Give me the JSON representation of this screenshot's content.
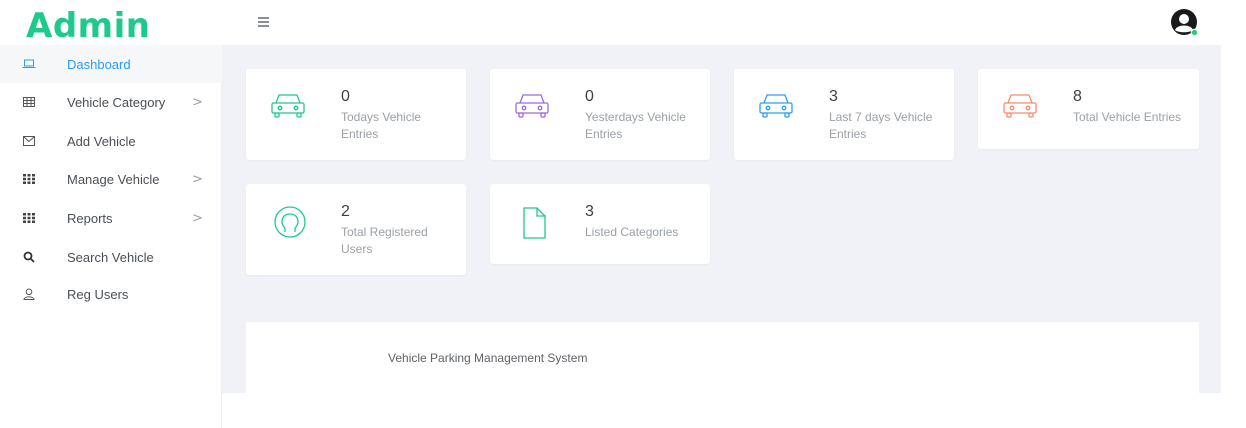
{
  "header": {
    "logo": "Admin",
    "menu_icon": "hamburger-icon",
    "avatar_icon": "user-avatar-icon",
    "accent_color": "#1ec98b",
    "status_dot_color": "#2ecc71"
  },
  "sidebar": {
    "items": [
      {
        "label": "Dashboard",
        "icon": "laptop-icon",
        "active": true
      },
      {
        "label": "Vehicle Category",
        "icon": "table-icon",
        "has_submenu": true
      },
      {
        "label": "Add Vehicle",
        "icon": "envelope-icon"
      },
      {
        "label": "Manage Vehicle",
        "icon": "grid-icon",
        "has_submenu": true
      },
      {
        "label": "Reports",
        "icon": "grid-icon",
        "has_submenu": true
      },
      {
        "label": "Search Vehicle",
        "icon": "search-icon"
      },
      {
        "label": "Reg Users",
        "icon": "user-icon"
      }
    ],
    "arrow": ">"
  },
  "stats": [
    {
      "value": "0",
      "label": "Todays Vehicle Entries",
      "icon": "car-icon",
      "color": "#1ec98b"
    },
    {
      "value": "0",
      "label": "Yesterdays Vehicle Entries",
      "icon": "car-icon",
      "color": "#9b6bdc"
    },
    {
      "value": "3",
      "label": "Last 7 days Vehicle Entries",
      "icon": "car-icon",
      "color": "#2a9df4"
    },
    {
      "value": "8",
      "label": "Total Vehicle Entries",
      "icon": "car-icon",
      "color": "#fa8c6a"
    },
    {
      "value": "2",
      "label": "Total Registered Users",
      "icon": "user-circle-icon",
      "color": "#1ec98b"
    },
    {
      "value": "3",
      "label": "Listed Categories",
      "icon": "file-icon",
      "color": "#1ec98b"
    }
  ],
  "footer": {
    "text": "Vehicle Parking Management System"
  }
}
